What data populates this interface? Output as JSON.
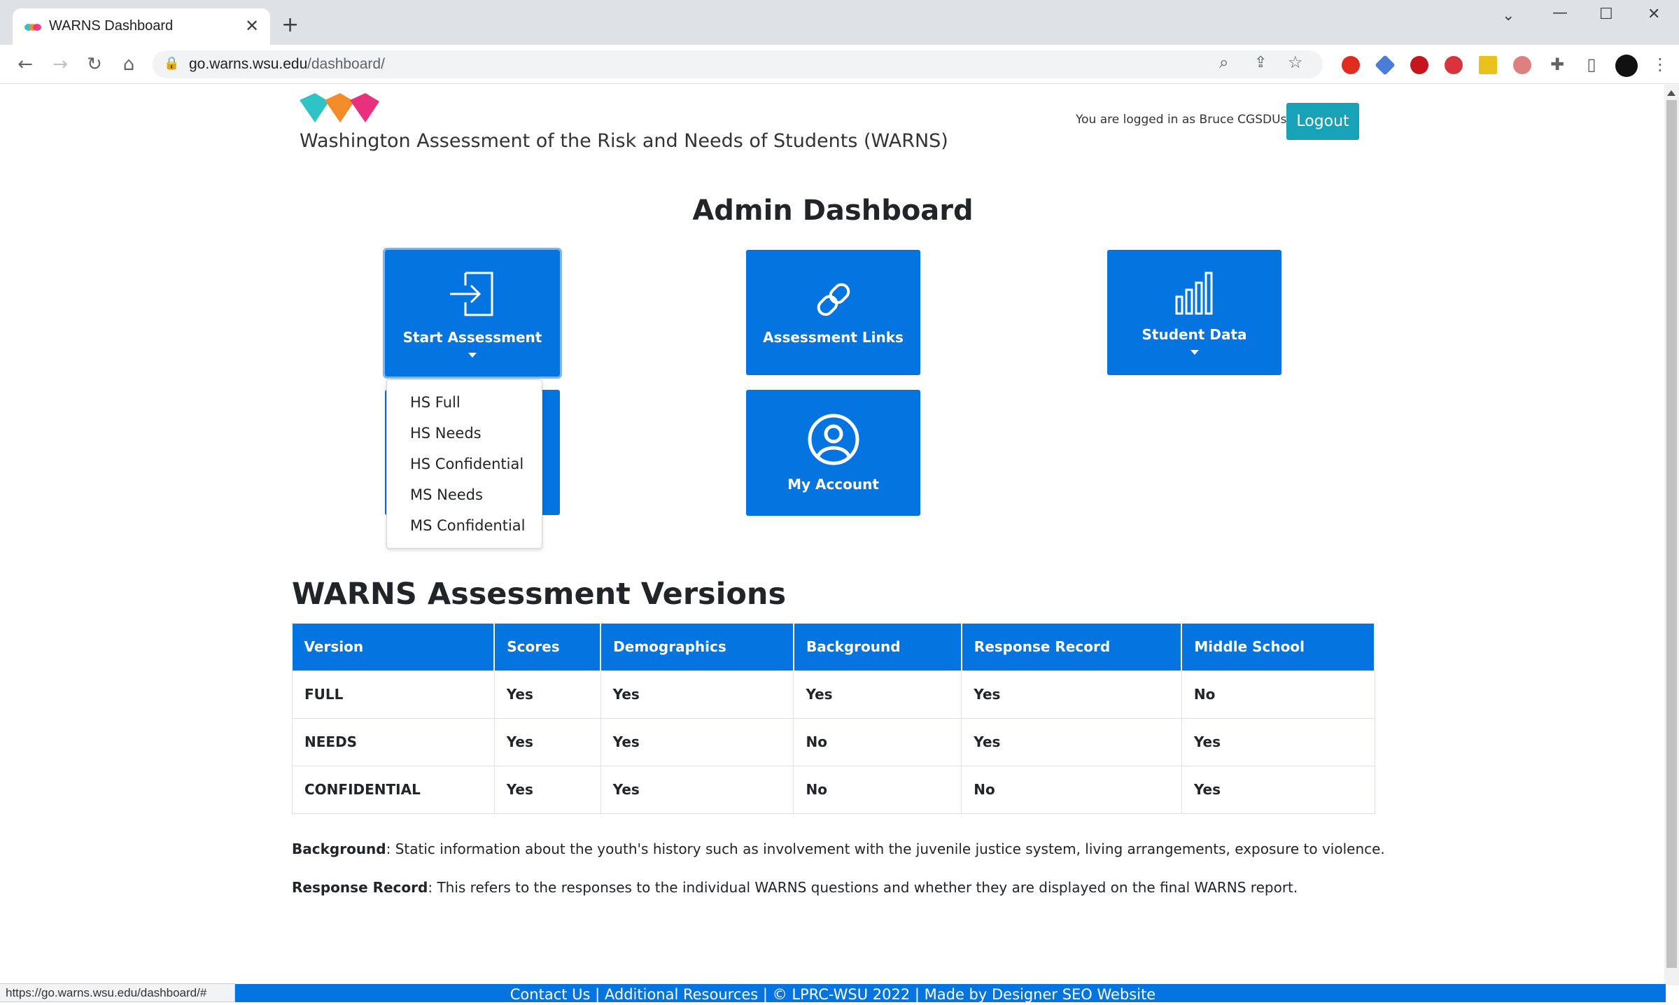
{
  "browser": {
    "tab_title": "WARNS Dashboard",
    "url_host": "go.warns.wsu.edu",
    "url_path": "/dashboard/",
    "status_url": "https://go.warns.wsu.edu/dashboard/#"
  },
  "header": {
    "site_title": "Washington Assessment of the Risk and Needs of Students (WARNS)",
    "login_text": "You are logged in as Bruce CGSDUser",
    "logout_label": "Logout",
    "logo_colors": [
      "#2ec4c6",
      "#f28c28",
      "#e8307c"
    ]
  },
  "dashboard": {
    "title": "Admin Dashboard",
    "tiles": {
      "start_assessment": "Start Assessment",
      "assessment_links": "Assessment Links",
      "student_data": "Student Data",
      "my_account": "My Account"
    },
    "dropdown_items": [
      "HS Full",
      "HS Needs",
      "HS Confidential",
      "MS Needs",
      "MS Confidential"
    ]
  },
  "versions": {
    "heading": "WARNS Assessment Versions",
    "columns": [
      "Version",
      "Scores",
      "Demographics",
      "Background",
      "Response Record",
      "Middle School"
    ],
    "rows": [
      [
        "FULL",
        "Yes",
        "Yes",
        "Yes",
        "Yes",
        "No"
      ],
      [
        "NEEDS",
        "Yes",
        "Yes",
        "No",
        "Yes",
        "Yes"
      ],
      [
        "CONFIDENTIAL",
        "Yes",
        "Yes",
        "No",
        "No",
        "Yes"
      ]
    ]
  },
  "notes": {
    "background_term": "Background",
    "background_text": ": Static information about the youth's history such as involvement with the juvenile justice system, living arrangements, exposure to violence.",
    "response_term": "Response Record",
    "response_text": ": This refers to the responses to the individual WARNS questions and whether they are displayed on the final WARNS report."
  },
  "footer": {
    "text": "Contact Us | Additional Resources | © LPRC-WSU 2022 | Made by Designer SEO Website"
  },
  "colors": {
    "primary": "#0374e0",
    "logout": "#17a2b8"
  }
}
